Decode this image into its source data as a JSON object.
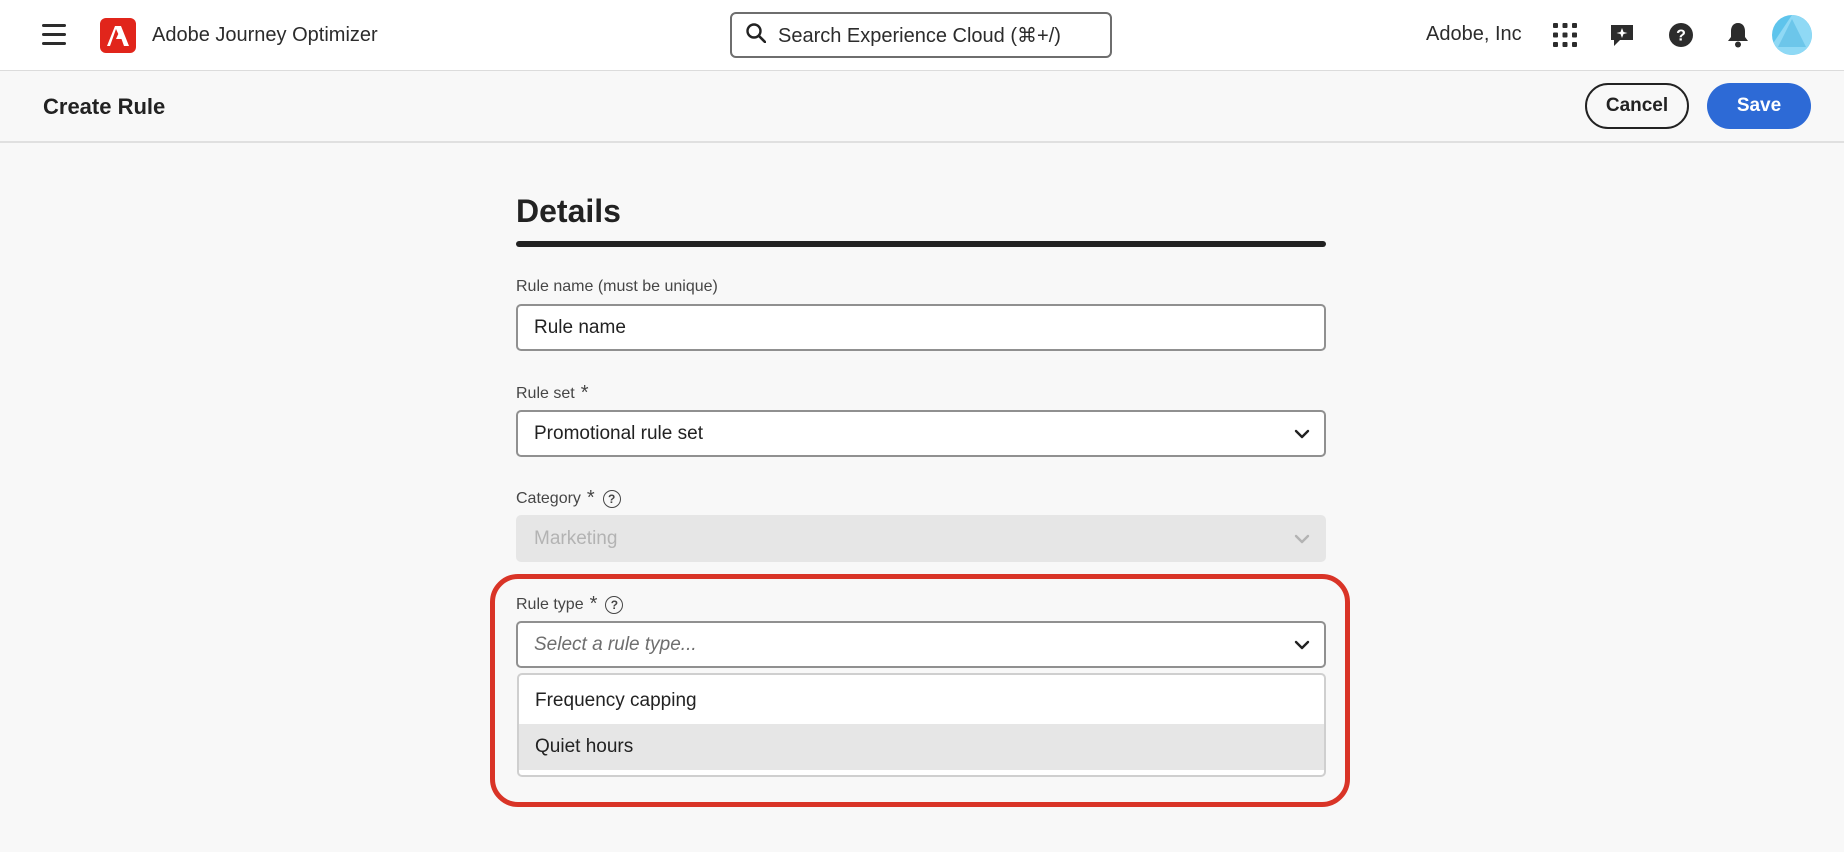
{
  "app": {
    "title": "Adobe Journey Optimizer",
    "org": "Adobe, Inc"
  },
  "search": {
    "placeholder": "Search Experience Cloud (⌘+/)"
  },
  "icons": {
    "menu": "hamburger-icon",
    "logo": "adobe-logo",
    "search": "search-icon",
    "apps": "apps-grid-icon",
    "feedback": "feedback-icon",
    "help": "help-icon",
    "notifications": "bell-icon",
    "avatar": "user-avatar"
  },
  "colors": {
    "brand": "#e1251b",
    "accent": "#2d6ad6",
    "highlight": "#d93427"
  },
  "header": {
    "title": "Create Rule",
    "cancel_label": "Cancel",
    "save_label": "Save"
  },
  "form": {
    "section_title": "Details",
    "rule_name": {
      "label": "Rule name (must be unique)",
      "value": "Rule name"
    },
    "rule_set": {
      "label": "Rule set",
      "required": "*",
      "value": "Promotional rule set"
    },
    "category": {
      "label": "Category",
      "required": "*",
      "help": "?",
      "value": "Marketing",
      "disabled": true
    },
    "rule_type": {
      "label": "Rule type",
      "required": "*",
      "help": "?",
      "placeholder": "Select a rule type...",
      "options": [
        "Frequency capping",
        "Quiet hours"
      ],
      "hovered_option": "Quiet hours"
    }
  }
}
